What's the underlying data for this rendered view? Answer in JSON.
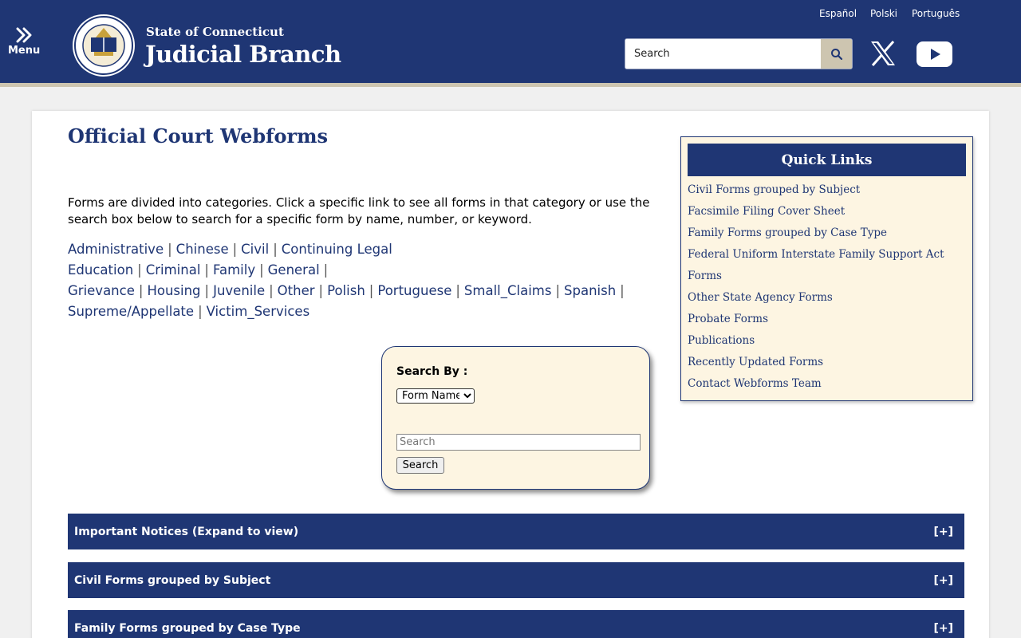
{
  "header": {
    "menu_label": "Menu",
    "brand_top": "State of Connecticut",
    "brand_main": "Judicial Branch",
    "languages": [
      "Español",
      "Polski",
      "Português"
    ],
    "search_placeholder": "Search",
    "colors": {
      "primary": "#1f3674",
      "accent": "#cdc5b0",
      "panel": "#fdf5e2"
    }
  },
  "main": {
    "title": "Official Court Webforms",
    "intro": "Forms are divided into categories. Click a specific link to see all forms in that category or use the search box below to search for a specific form by name, number, or keyword.",
    "categories": [
      "Administrative",
      "Chinese",
      "Civil",
      "Continuing Legal Education",
      "Criminal",
      "Family",
      "General",
      "Grievance",
      "Housing",
      "Juvenile",
      "Other",
      "Polish",
      "Portuguese",
      "Small_Claims",
      "Spanish",
      "Supreme/Appellate",
      "Victim_Services"
    ]
  },
  "search_panel": {
    "label": "Search By :",
    "select_value": "Form Name",
    "input_placeholder": "Search",
    "button": "Search"
  },
  "quick_links": {
    "title": "Quick Links",
    "items": [
      "Civil Forms grouped by Subject",
      "Facsimile Filing Cover Sheet",
      "Family Forms grouped by Case Type",
      "Federal Uniform Interstate Family Support Act",
      "Forms",
      "Other State Agency Forms",
      "Probate Forms",
      "Publications",
      "Recently Updated Forms",
      "Contact Webforms Team"
    ]
  },
  "accordions": [
    {
      "label": "Important Notices (Expand to view)",
      "toggle": "[+]"
    },
    {
      "label": "Civil Forms grouped by Subject",
      "toggle": "[+]"
    },
    {
      "label": "Family Forms grouped by Case Type",
      "toggle": "[+]"
    }
  ]
}
